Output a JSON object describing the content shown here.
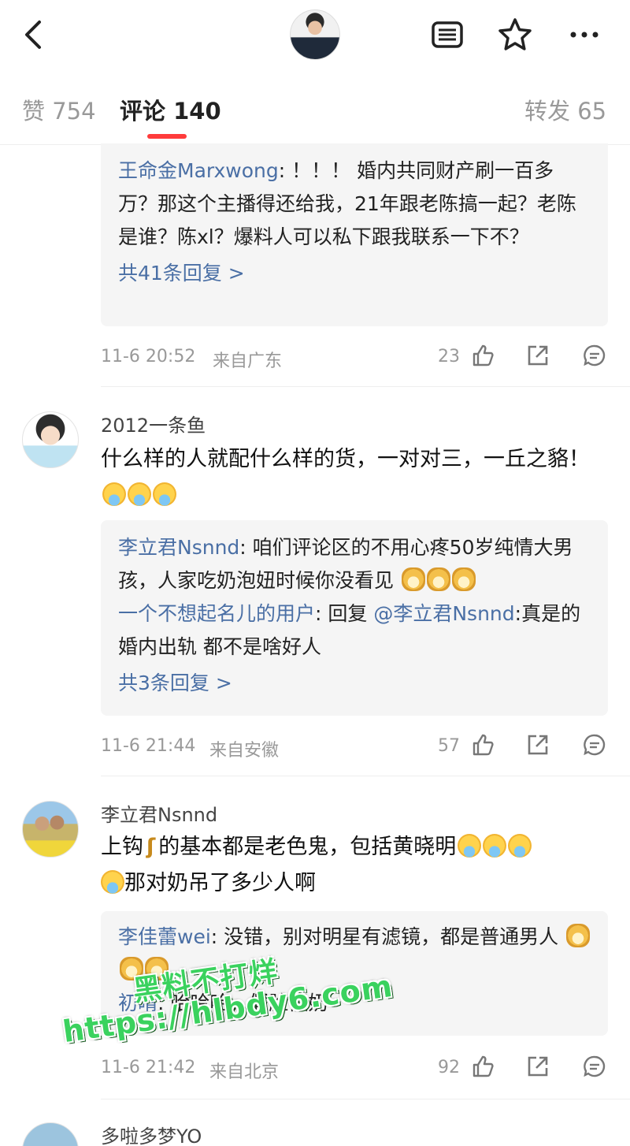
{
  "header": {
    "back_icon": "chevron-left-icon",
    "more_icon": "more-dots-icon"
  },
  "tabs": [
    {
      "label": "赞 754"
    },
    {
      "label": "评论 140"
    },
    {
      "label": "转发 65"
    }
  ],
  "thread1": {
    "reply_user": "王命金Marxwong",
    "reply_text": ": ！！！ 婚内共同财产刷一百多万？那这个主播得还给我，21年跟老陈搞一起？老陈是谁？陈xl？爆料人可以私下跟我联系一下不？",
    "more": "共41条回复 >",
    "time": "11-6 20:52",
    "location": "来自广东",
    "likes": "23"
  },
  "comment2": {
    "author": "2012一条鱼",
    "text": "什么样的人就配什么样的货，一对对三，一丘之貉！",
    "replies": [
      {
        "user": "李立君Nsnnd",
        "text": ": 咱们评论区的不用心疼50岁纯情大男孩，人家吃奶泡妞时候你没看见"
      },
      {
        "user": "一个不想起名儿的用户",
        "text": ": 回复 ",
        "mention": "@李立君Nsnnd",
        "tail": ":真是的 婚内出轨 都不是啥好人"
      }
    ],
    "more": "共3条回复 >",
    "time": "11-6 21:44",
    "location": "来自安徽",
    "likes": "57"
  },
  "comment3": {
    "author": "李立君Nsnnd",
    "text_a": "上钩",
    "text_b": "的基本都是老色鬼，包括黄晓明",
    "text_c": "那对奶吊了多少人啊",
    "replies": [
      {
        "user": "李佳蕾wei",
        "text": ": 没错，别对明星有滤镜，都是普通男人"
      },
      {
        "user": "初晴",
        "text": ": 哈哈哈，假脸假奶"
      }
    ],
    "time": "11-6 21:42",
    "location": "来自北京",
    "likes": "92"
  },
  "comment4": {
    "author": "多啦多梦YO"
  },
  "watermark": {
    "line1": "黑料不打烊",
    "line2": "https://hlbdy6.com"
  }
}
